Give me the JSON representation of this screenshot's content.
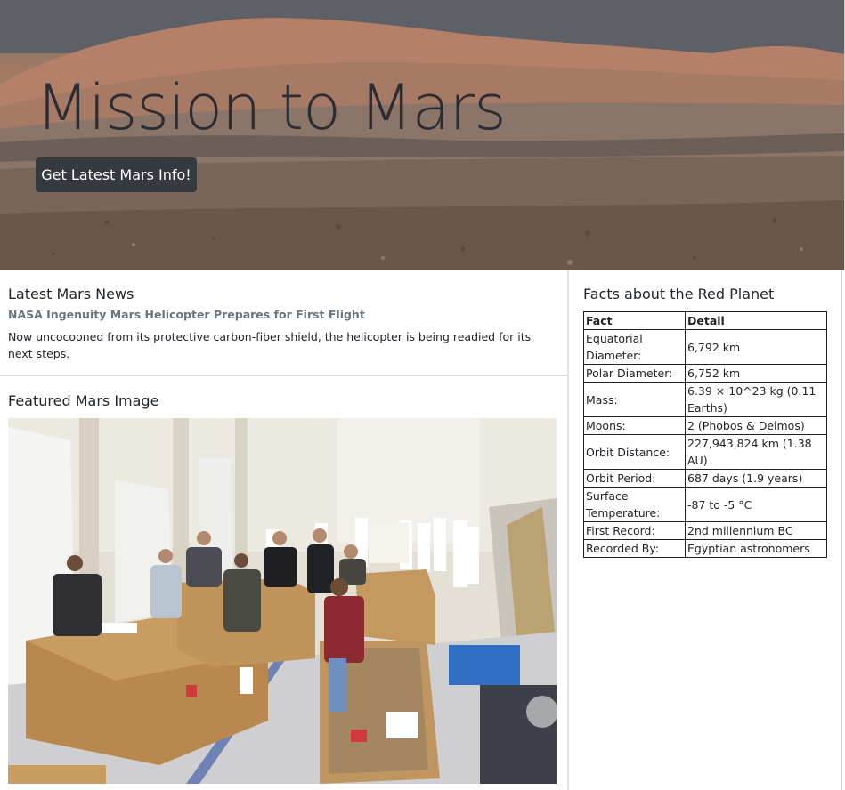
{
  "hero": {
    "title": "Mission to Mars",
    "button_label": "Get Latest Mars Info!"
  },
  "news": {
    "heading": "Latest Mars News",
    "title": "NASA Ingenuity Mars Helicopter Prepares for First Flight",
    "body": "Now uncocooned from its protective carbon-fiber shield, the helicopter is being readied for its next steps."
  },
  "featured": {
    "heading": "Featured Mars Image"
  },
  "facts": {
    "heading": "Facts about the Red Planet",
    "columns": [
      "Fact",
      "Detail"
    ],
    "rows": [
      [
        "Equatorial Diameter:",
        "6,792 km"
      ],
      [
        "Polar Diameter:",
        "6,752 km"
      ],
      [
        "Mass:",
        "6.39 × 10^23 kg (0.11 Earths)"
      ],
      [
        "Moons:",
        "2 (Phobos & Deimos)"
      ],
      [
        "Orbit Distance:",
        "227,943,824 km (1.38 AU)"
      ],
      [
        "Orbit Period:",
        "687 days (1.9 years)"
      ],
      [
        "Surface Temperature:",
        "-87 to -5 °C"
      ],
      [
        "First Record:",
        "2nd millennium BC"
      ],
      [
        "Recorded By:",
        "Egyptian astronomers"
      ]
    ]
  }
}
